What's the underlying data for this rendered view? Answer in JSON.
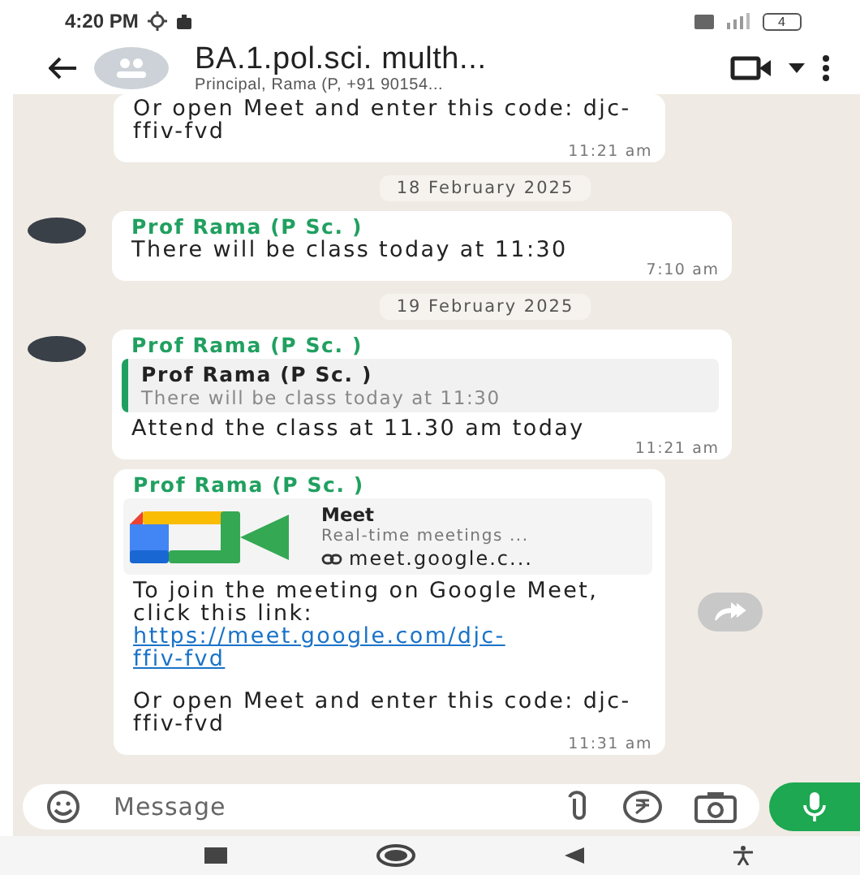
{
  "status_bar": {
    "time": "4:20 PM",
    "battery": "4"
  },
  "header": {
    "title": "BA.1.pol.sci. multh...",
    "subtitle": "Principal, Rama (P, +91 90154..."
  },
  "chat": [
    {
      "kind": "message",
      "avatar": false,
      "body": "Or open Meet and enter this code: djc-ffiv-fvd",
      "time": "11:21 am"
    },
    {
      "kind": "date",
      "label": "18 February 2025"
    },
    {
      "kind": "message",
      "avatar": true,
      "sender": "Prof Rama (P Sc. )",
      "body": "There will be class today at 11:30",
      "time": "7:10 am"
    },
    {
      "kind": "date",
      "label": "19 February 2025"
    },
    {
      "kind": "reply",
      "avatar": true,
      "sender": "Prof Rama (P Sc. )",
      "quote_sender": "Prof Rama (P Sc. )",
      "quote_text": "There will be class today at 11:30",
      "body": "Attend the class at 11.30 am today",
      "time": "11:21 am"
    },
    {
      "kind": "link",
      "avatar": false,
      "sender": "Prof Rama (P Sc. )",
      "preview_title": "Meet",
      "preview_description": "Real-time meetings ...",
      "preview_url": "meet.google.c...",
      "body": "To join the meeting on Google Meet, click this link:",
      "link": "https://meet.google.com/djc-ffiv-fvd",
      "body_after": "Or open Meet and enter this code: djc-ffiv-fvd",
      "time": "11:31 am",
      "forward": true
    }
  ],
  "composer": {
    "placeholder": "Message"
  }
}
